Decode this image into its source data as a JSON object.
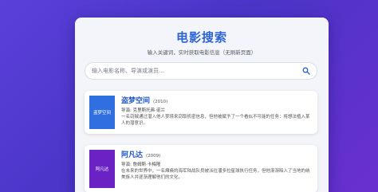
{
  "header": {
    "title": "电影搜索",
    "subtitle": "输入关键词，实时获取电影信息（无刷新页面）"
  },
  "search": {
    "placeholder": "输入电影名称、导演或演员...",
    "value": ""
  },
  "colors": {
    "title": "#2b63d6",
    "poster1": "#2f6fe0",
    "poster2": "#6a22c4"
  },
  "results": [
    {
      "poster_text": "盗梦空间",
      "name": "盗梦空间",
      "year": "(2010)",
      "director": "导演: 克里斯托弗·诺兰",
      "description": "一名窃贼通过潜入他人梦境来窃取机密信息，但他被赋予了一个看似不可能的任务：将想法植入某人的潜意识。"
    },
    {
      "poster_text": "阿凡达",
      "name": "阿凡达",
      "year": "(2009)",
      "director": "导演: 詹姆斯·卡梅隆",
      "description": "在未来的世界中，一名瘫痪的海军陆战队员被派往潘多拉星球执行任务，但他渐渐陷入了当地的纳美族人并逐渐理解他们的文化。"
    }
  ]
}
